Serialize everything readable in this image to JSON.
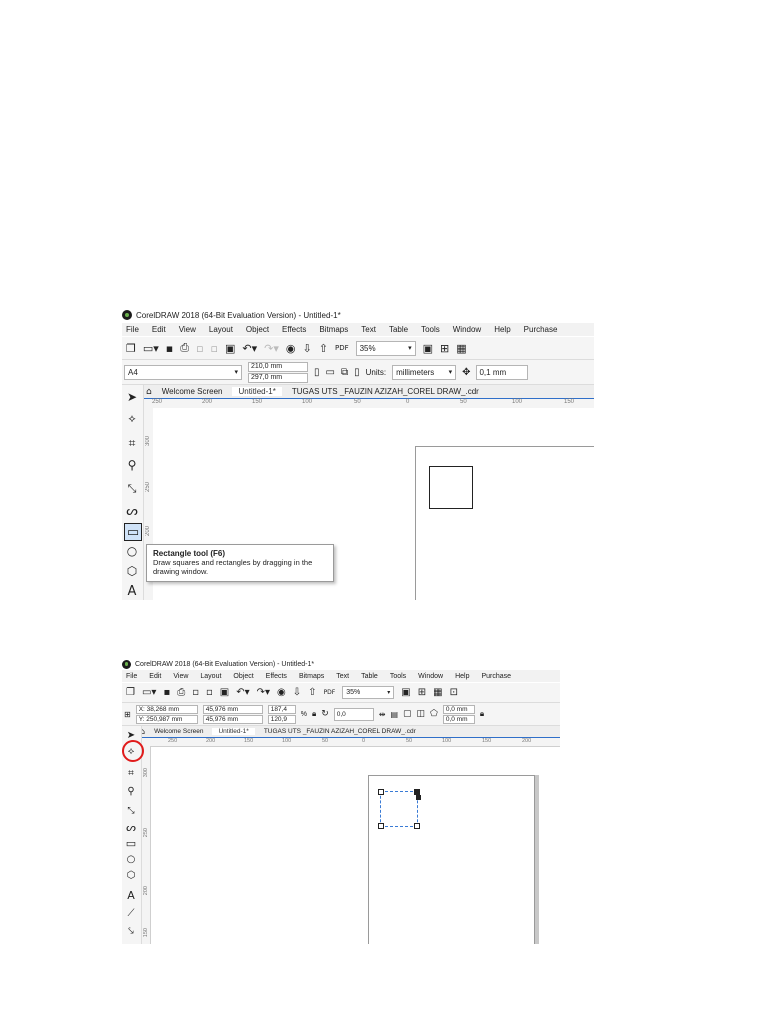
{
  "shot1": {
    "title": "CorelDRAW 2018 (64-Bit Evaluation Version) - Untitled-1*",
    "menu": [
      "File",
      "Edit",
      "View",
      "Layout",
      "Object",
      "Effects",
      "Bitmaps",
      "Text",
      "Table",
      "Tools",
      "Window",
      "Help",
      "Purchase"
    ],
    "zoom": "35%",
    "page_size": "A4",
    "width": "210,0 mm",
    "height": "297,0 mm",
    "units_label": "Units:",
    "units_value": "millimeters",
    "nudge": "0,1 mm",
    "tabs": [
      "Welcome Screen",
      "Untitled-1*",
      "TUGAS UTS _FAUZIN AZIZAH_COREL DRAW_.cdr"
    ],
    "ruler_ticks": [
      "250",
      "200",
      "150",
      "100",
      "50",
      "0",
      "50",
      "100",
      "150"
    ],
    "vruler_ticks": [
      "300",
      "250",
      "200"
    ],
    "tooltip": {
      "title": "Rectangle tool (F6)",
      "body": "Draw squares and rectangles by dragging in the drawing window."
    }
  },
  "shot2": {
    "title": "CorelDRAW 2018 (64-Bit Evaluation Version) - Untitled-1*",
    "menu": [
      "File",
      "Edit",
      "View",
      "Layout",
      "Object",
      "Effects",
      "Bitmaps",
      "Text",
      "Table",
      "Tools",
      "Window",
      "Help",
      "Purchase"
    ],
    "zoom": "35%",
    "x": "X: 38,268 mm",
    "y": "Y: 250,987 mm",
    "w": "45,976 mm",
    "h": "45,976 mm",
    "sx": "187,4",
    "sy": "120,9",
    "pct": "%",
    "angle": "0,0",
    "corner1": "0,0 mm",
    "corner2": "0,0 mm",
    "tabs": [
      "Welcome Screen",
      "Untitled-1*",
      "TUGAS UTS _FAUZIN AZIZAH_COREL DRAW_.cdr"
    ],
    "ruler_ticks": [
      "250",
      "200",
      "150",
      "100",
      "50",
      "0",
      "50",
      "100",
      "150",
      "200"
    ],
    "vruler_ticks": [
      "300",
      "250",
      "200",
      "150"
    ]
  },
  "colors": {
    "highlight": "#e01b1b",
    "selection": "#3a7bd5",
    "tab_accent": "#2f6fc9"
  }
}
